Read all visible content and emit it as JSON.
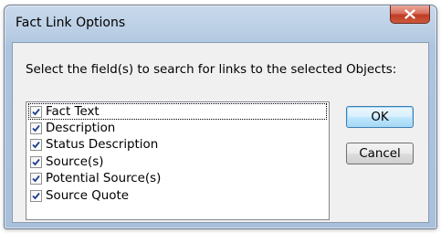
{
  "window": {
    "title": "Fact Link Options"
  },
  "prompt": "Select the field(s) to search for links to the selected Objects:",
  "fields": [
    {
      "label": "Fact Text",
      "checked": true
    },
    {
      "label": "Description",
      "checked": true
    },
    {
      "label": "Status Description",
      "checked": true
    },
    {
      "label": "Source(s)",
      "checked": true
    },
    {
      "label": "Potential Source(s)",
      "checked": true
    },
    {
      "label": "Source Quote",
      "checked": true
    }
  ],
  "buttons": {
    "ok": "OK",
    "cancel": "Cancel"
  },
  "icons": {
    "close": "close-icon",
    "check": "checkmark-icon"
  },
  "colors": {
    "close_button": "#c03b24",
    "titlebar": "#b9cde4",
    "default_button": "#3c7fb1"
  }
}
